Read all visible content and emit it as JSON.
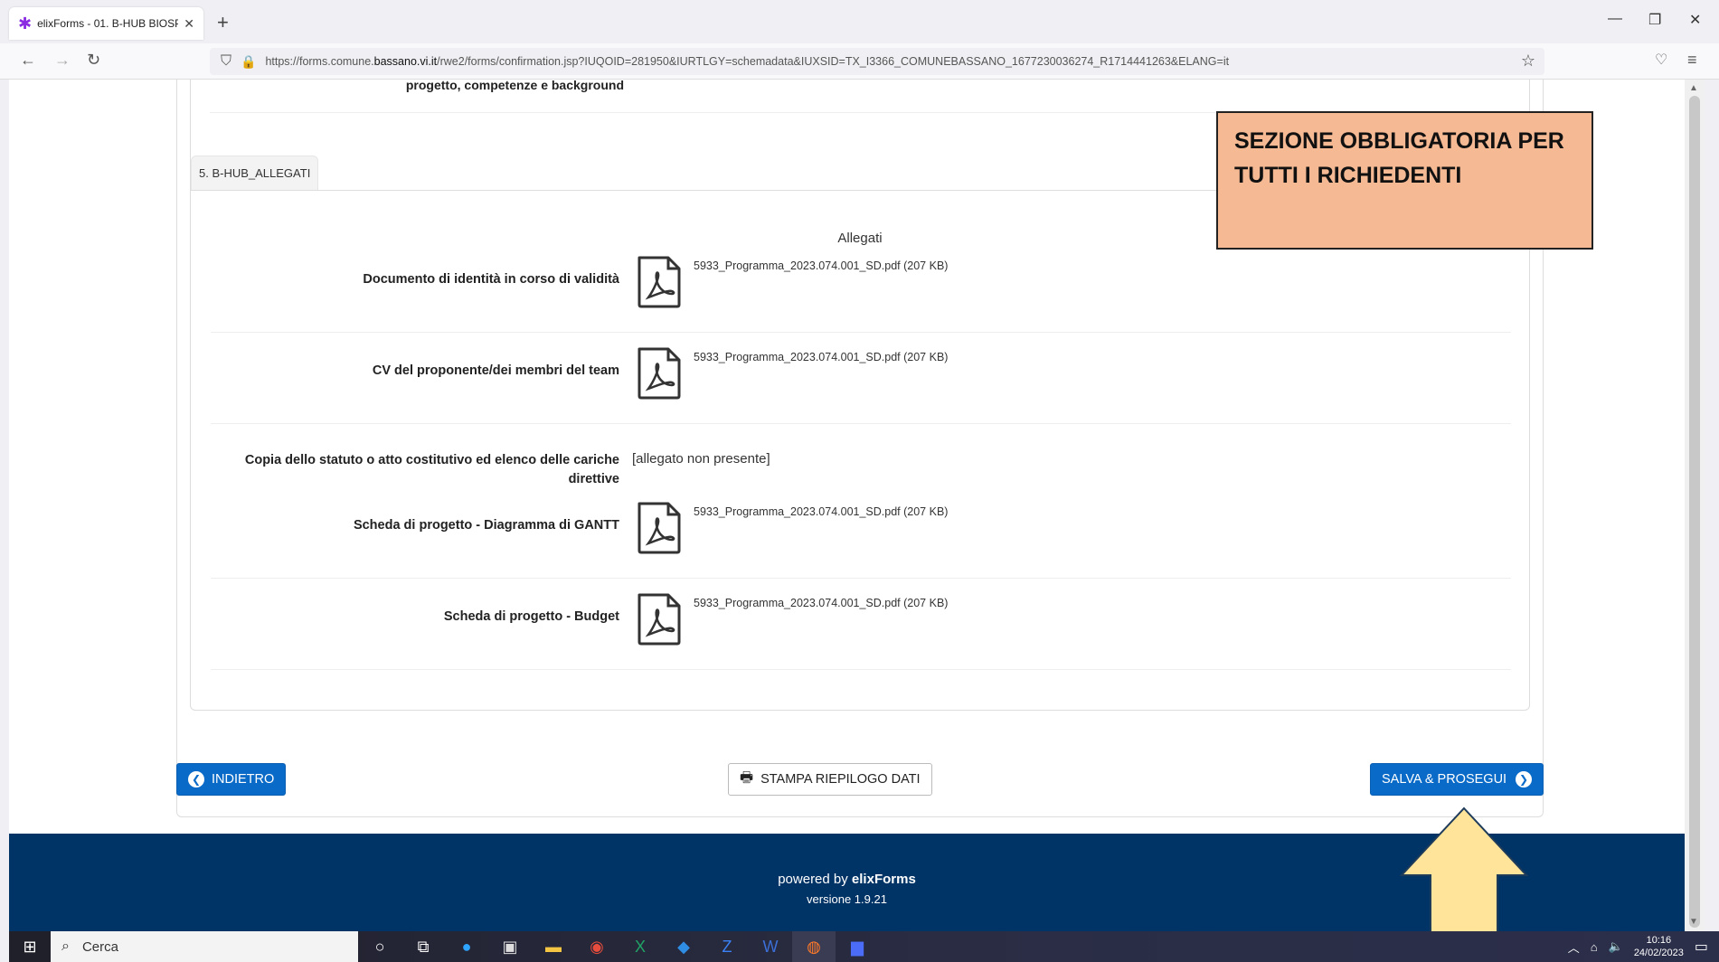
{
  "browser": {
    "tab_title": "elixForms - 01. B-HUB BIOSPHE",
    "url_prefix": "https://forms.comune.",
    "url_domain": "bassano.vi.it",
    "url_rest": "/rwe2/forms/confirmation.jsp?IUQOID=281950&IURTLGY=schemadata&IUXSID=TX_I3366_COMUNEBASSANO_1677230036274_R1714441263&ELANG=it"
  },
  "prev_section": {
    "label": "progetto, competenze e background"
  },
  "section": {
    "tab_label": "5. B-HUB_ALLEGATI",
    "subtitle": "Allegati",
    "rows": [
      {
        "label": "Documento di identità in corso di validità",
        "file": "5933_Programma_2023.074.001_SD.pdf (207 KB)"
      },
      {
        "label": "CV del proponente/dei membri del team",
        "file": "5933_Programma_2023.074.001_SD.pdf (207 KB)"
      },
      {
        "label": "Copia dello statuto o atto costitutivo ed elenco delle cariche direttive",
        "missing": "[allegato non presente]"
      },
      {
        "label": "Scheda di progetto - Diagramma di GANTT",
        "file": "5933_Programma_2023.074.001_SD.pdf (207 KB)"
      },
      {
        "label": "Scheda di progetto - Budget",
        "file": "5933_Programma_2023.074.001_SD.pdf (207 KB)"
      }
    ]
  },
  "buttons": {
    "back": "INDIETRO",
    "print": "STAMPA RIEPILOGO DATI",
    "save": "SALVA & PROSEGUI"
  },
  "footer": {
    "powered_prefix": "powered by ",
    "brand": "elixForms",
    "version": "versione 1.9.21"
  },
  "annotation": {
    "note": "SEZIONE OBBLIGATORIA PER TUTTI I RICHIEDENTI"
  },
  "taskbar": {
    "search_placeholder": "Cerca",
    "time": "10:16",
    "date": "24/02/2023"
  },
  "colors": {
    "primary": "#0a6ac7",
    "footer": "#003366",
    "note_bg": "#f5b994",
    "arrow_fill": "#ffe49a"
  }
}
